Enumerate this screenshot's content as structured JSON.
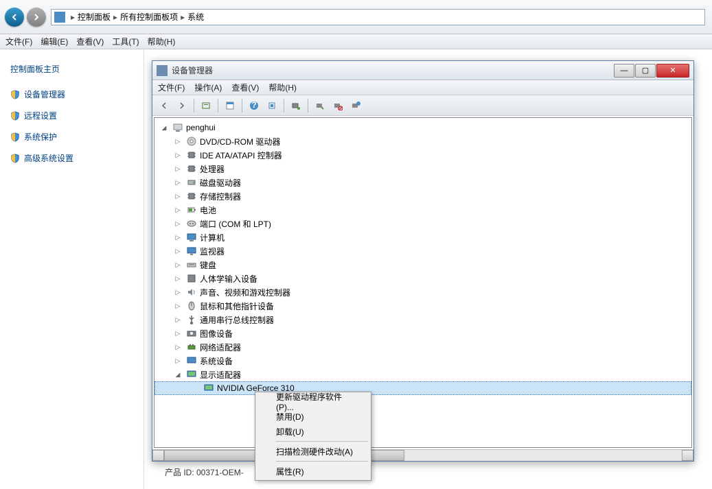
{
  "nav": {
    "segments": [
      "控制面板",
      "所有控制面板项",
      "系统"
    ]
  },
  "main_menu": {
    "file": "文件(F)",
    "edit": "编辑(E)",
    "view": "查看(V)",
    "tools": "工具(T)",
    "help": "帮助(H)"
  },
  "sidebar": {
    "home": "控制面板主页",
    "links": [
      {
        "label": "设备管理器"
      },
      {
        "label": "远程设置"
      },
      {
        "label": "系统保护"
      },
      {
        "label": "高级系统设置"
      }
    ]
  },
  "dm": {
    "title": "设备管理器",
    "menu": {
      "file": "文件(F)",
      "action": "操作(A)",
      "view": "查看(V)",
      "help": "帮助(H)"
    },
    "root": "penghui",
    "nodes": [
      {
        "label": "DVD/CD-ROM 驱动器"
      },
      {
        "label": "IDE ATA/ATAPI 控制器"
      },
      {
        "label": "处理器"
      },
      {
        "label": "磁盘驱动器"
      },
      {
        "label": "存储控制器"
      },
      {
        "label": "电池"
      },
      {
        "label": "端口 (COM 和 LPT)"
      },
      {
        "label": "计算机"
      },
      {
        "label": "监视器"
      },
      {
        "label": "键盘"
      },
      {
        "label": "人体学输入设备"
      },
      {
        "label": "声音、视频和游戏控制器"
      },
      {
        "label": "鼠标和其他指针设备"
      },
      {
        "label": "通用串行总线控制器"
      },
      {
        "label": "图像设备"
      },
      {
        "label": "网络适配器"
      },
      {
        "label": "系统设备"
      },
      {
        "label": "显示适配器",
        "expanded": true,
        "children": [
          {
            "label": "NVIDIA GeForce 310"
          }
        ]
      }
    ]
  },
  "context_menu": {
    "update": "更新驱动程序软件(P)...",
    "disable": "禁用(D)",
    "uninstall": "卸载(U)",
    "scan": "扫描检测硬件改动(A)",
    "properties": "属性(R)"
  },
  "footer": {
    "product_id": "产品 ID: 00371-OEM-"
  }
}
